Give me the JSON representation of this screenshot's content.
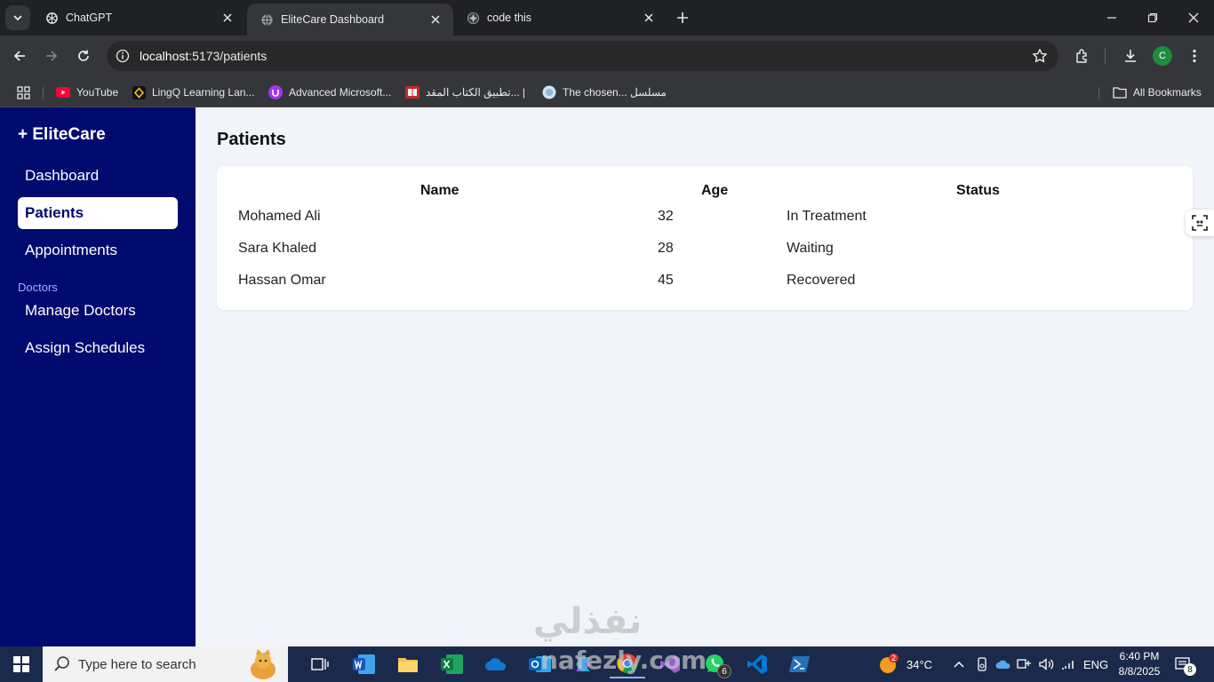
{
  "browser": {
    "tabs": [
      {
        "title": "ChatGPT",
        "icon": "chatgpt-icon",
        "active": false
      },
      {
        "title": "EliteCare Dashboard",
        "icon": "globe-icon",
        "active": true
      },
      {
        "title": "code this",
        "icon": "gem-icon",
        "active": false
      }
    ],
    "url": {
      "host": "localhost",
      "path": ":5173/patients"
    },
    "profile_initial": "C",
    "bookmarks": [
      {
        "label": "YouTube",
        "icon": "youtube-icon"
      },
      {
        "label": "LingQ Learning Lan...",
        "icon": "lingq-icon"
      },
      {
        "label": "Advanced Microsoft...",
        "icon": "udemy-icon"
      },
      {
        "label": "تطبيق الكتاب المقد... |",
        "icon": "book-app-icon"
      },
      {
        "label": "The chosen... مسلسل",
        "icon": "globe-bookmark-icon"
      }
    ],
    "all_bookmarks_label": "All Bookmarks"
  },
  "sidebar": {
    "brand": "+ EliteCare",
    "items": [
      {
        "label": "Dashboard",
        "active": false
      },
      {
        "label": "Patients",
        "active": true
      },
      {
        "label": "Appointments",
        "active": false
      }
    ],
    "section_label": "Doctors",
    "doctor_items": [
      {
        "label": "Manage Doctors"
      },
      {
        "label": "Assign Schedules"
      }
    ]
  },
  "main": {
    "title": "Patients",
    "table": {
      "headers": [
        "Name",
        "Age",
        "Status"
      ],
      "rows": [
        {
          "name": "Mohamed Ali",
          "age": "32",
          "status": "In Treatment"
        },
        {
          "name": "Sara Khaled",
          "age": "28",
          "status": "Waiting"
        },
        {
          "name": "Hassan Omar",
          "age": "45",
          "status": "Recovered"
        }
      ]
    }
  },
  "watermark": {
    "arabic": "نفذلي",
    "latin": "nafezly.com"
  },
  "taskbar": {
    "search_placeholder": "Type here to search",
    "weather": {
      "temp": "34°C",
      "badge": "2"
    },
    "whatsapp_badge": "6",
    "language": "ENG",
    "time": "6:40 PM",
    "date": "8/8/2025",
    "notification_count": "8"
  },
  "colors": {
    "sidebar": "#010a6e",
    "content_bg": "#f2f4fb",
    "accent": "#010a6e"
  }
}
